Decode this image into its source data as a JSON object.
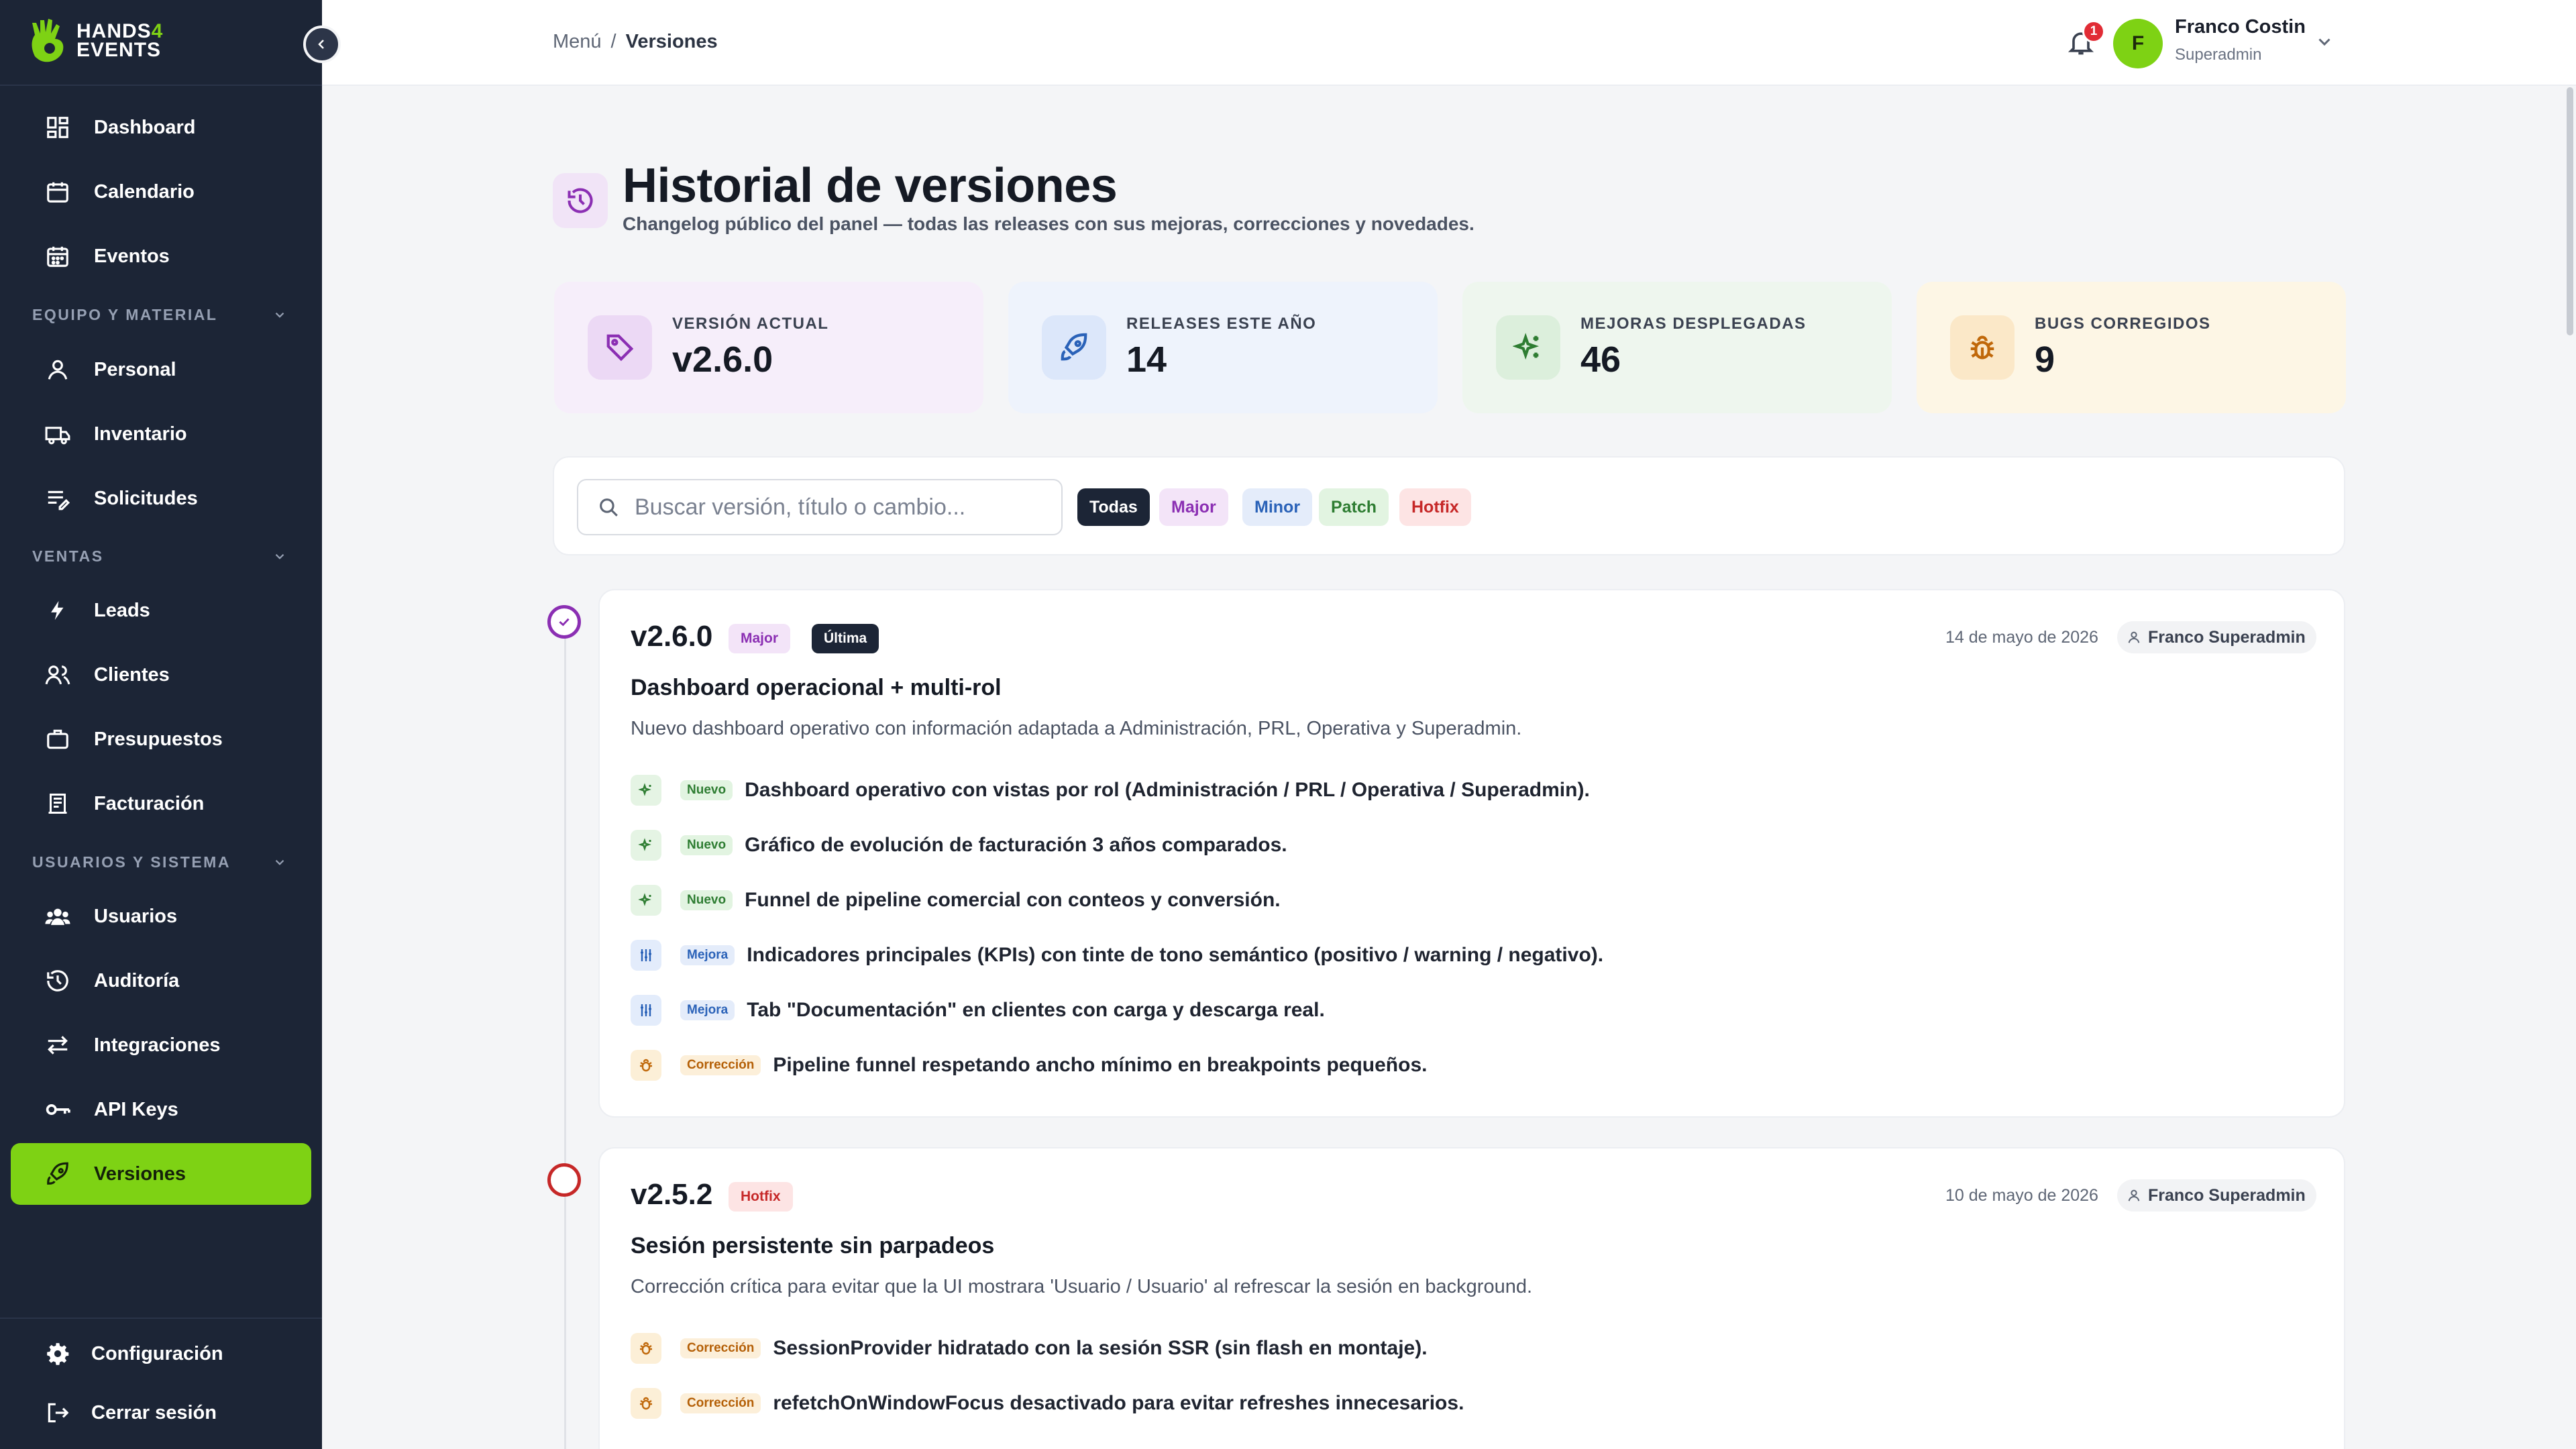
{
  "brand": {
    "line1": "HANDS",
    "four": "4",
    "line2": "EVENTS",
    "accent": "#7ed214"
  },
  "sidebar": {
    "top_items": [
      {
        "label": "Dashboard",
        "icon": "dashboard-icon"
      },
      {
        "label": "Calendario",
        "icon": "calendar-icon"
      },
      {
        "label": "Eventos",
        "icon": "events-calendar-icon"
      }
    ],
    "sections": [
      {
        "title": "EQUIPO Y MATERIAL",
        "items": [
          {
            "label": "Personal",
            "icon": "person-icon"
          },
          {
            "label": "Inventario",
            "icon": "truck-icon"
          },
          {
            "label": "Solicitudes",
            "icon": "request-icon"
          }
        ]
      },
      {
        "title": "VENTAS",
        "items": [
          {
            "label": "Leads",
            "icon": "bolt-icon"
          },
          {
            "label": "Clientes",
            "icon": "clients-icon"
          },
          {
            "label": "Presupuestos",
            "icon": "briefcase-icon"
          },
          {
            "label": "Facturación",
            "icon": "invoice-icon"
          }
        ]
      },
      {
        "title": "USUARIOS Y SISTEMA",
        "items": [
          {
            "label": "Usuarios",
            "icon": "users-icon"
          },
          {
            "label": "Auditoría",
            "icon": "history-icon"
          },
          {
            "label": "Integraciones",
            "icon": "arrows-icon"
          },
          {
            "label": "API Keys",
            "icon": "key-icon"
          },
          {
            "label": "Versiones",
            "icon": "rocket-icon",
            "active": true
          }
        ]
      }
    ],
    "bottom": {
      "settings": "Configuración",
      "logout": "Cerrar sesión"
    }
  },
  "topbar": {
    "breadcrumb": {
      "root": "Menú",
      "separator": "/",
      "current": "Versiones"
    },
    "notifications": "1",
    "user": {
      "initial": "F",
      "name": "Franco Costin",
      "role": "Superadmin"
    }
  },
  "page": {
    "title": "Historial de versiones",
    "subtitle": "Changelog público del panel — todas las releases con sus mejoras, correcciones y novedades."
  },
  "stats": [
    {
      "label": "VERSIÓN ACTUAL",
      "value": "v2.6.0",
      "icon": "tag-icon",
      "bg": "#f6eefa",
      "icon_bg": "#ecd9f5",
      "icon_color": "#8b2fb3"
    },
    {
      "label": "RELEASES ESTE AÑO",
      "value": "14",
      "icon": "rocket-icon",
      "bg": "#eef3fc",
      "icon_bg": "#dce7fa",
      "icon_color": "#2a62b8"
    },
    {
      "label": "MEJORAS DESPLEGADAS",
      "value": "46",
      "icon": "sparkles-icon",
      "bg": "#eef6ee",
      "icon_bg": "#dcefdc",
      "icon_color": "#2e7d32"
    },
    {
      "label": "BUGS CORREGIDOS",
      "value": "9",
      "icon": "bug-icon",
      "bg": "#fdf6e5",
      "icon_bg": "#fbe8c8",
      "icon_color": "#c0680a"
    }
  ],
  "filters": {
    "search_placeholder": "Buscar versión, título o cambio...",
    "chips": [
      {
        "label": "Todas",
        "active": true
      },
      {
        "label": "Major"
      },
      {
        "label": "Minor"
      },
      {
        "label": "Patch"
      },
      {
        "label": "Hotfix"
      }
    ]
  },
  "releases": [
    {
      "version": "v2.6.0",
      "type": "Major",
      "latest": "Última",
      "date": "14 de mayo de 2026",
      "author": "Franco Superadmin",
      "title": "Dashboard operacional + multi-rol",
      "description": "Nuevo dashboard operativo con información adaptada a Administración, PRL, Operativa y Superadmin.",
      "changes": [
        {
          "kind": "new",
          "tag": "Nuevo",
          "text": "Dashboard operativo con vistas por rol (Administración / PRL / Operativa / Superadmin)."
        },
        {
          "kind": "new",
          "tag": "Nuevo",
          "text": "Gráfico de evolución de facturación 3 años comparados."
        },
        {
          "kind": "new",
          "tag": "Nuevo",
          "text": "Funnel de pipeline comercial con conteos y conversión."
        },
        {
          "kind": "imp",
          "tag": "Mejora",
          "text": "Indicadores principales (KPIs) con tinte de tono semántico (positivo / warning / negativo)."
        },
        {
          "kind": "imp",
          "tag": "Mejora",
          "text": "Tab \"Documentación\" en clientes con carga y descarga real."
        },
        {
          "kind": "fix",
          "tag": "Corrección",
          "text": "Pipeline funnel respetando ancho mínimo en breakpoints pequeños."
        }
      ]
    },
    {
      "version": "v2.5.2",
      "type": "Hotfix",
      "date": "10 de mayo de 2026",
      "author": "Franco Superadmin",
      "title": "Sesión persistente sin parpadeos",
      "description": "Corrección crítica para evitar que la UI mostrara 'Usuario / Usuario' al refrescar la sesión en background.",
      "changes": [
        {
          "kind": "fix",
          "tag": "Corrección",
          "text": "SessionProvider hidratado con la sesión SSR (sin flash en montaje)."
        },
        {
          "kind": "fix",
          "tag": "Corrección",
          "text": "refetchOnWindowFocus desactivado para evitar refreshes innecesarios."
        }
      ]
    }
  ]
}
